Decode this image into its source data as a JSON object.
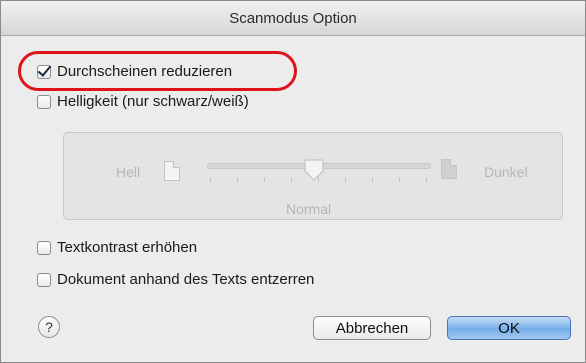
{
  "dialog": {
    "title": "Scanmodus Option",
    "options": {
      "bleed_through": {
        "label": "Durchscheinen reduzieren",
        "checked": true
      },
      "brightness": {
        "label": "Helligkeit (nur schwarz/weiß)",
        "checked": false
      },
      "contrast": {
        "label": "Textkontrast erhöhen",
        "checked": false
      },
      "deskew": {
        "label": "Dokument anhand des Texts entzerren",
        "checked": false
      }
    },
    "slider": {
      "left_label": "Hell",
      "right_label": "Dunkel",
      "value_label": "Normal",
      "value_fraction": 0.5,
      "enabled": false
    },
    "help_label": "?",
    "cancel_label": "Abbrechen",
    "ok_label": "OK"
  },
  "colors": {
    "highlight": "#e0121a",
    "default_button": "#76aee9"
  }
}
